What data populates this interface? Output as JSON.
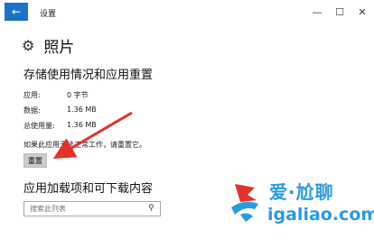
{
  "window": {
    "title": "设置",
    "back_glyph": "←",
    "minimize_glyph": "—",
    "maximize_glyph": "☐",
    "close_glyph": "✕"
  },
  "page": {
    "gear_glyph": "⚙",
    "title": "照片"
  },
  "storage": {
    "title": "存储使用情况和应用重置",
    "rows": [
      {
        "label": "应用:",
        "value": "0 字节"
      },
      {
        "label": "数据:",
        "value": "1.36 MB"
      },
      {
        "label": "总使用量:",
        "value": "1.36 MB"
      }
    ],
    "note": "如果此应用无法正常工作，请重置它。",
    "reset_label": "重置"
  },
  "addons": {
    "title": "应用加载项和可下载内容",
    "search_placeholder": "搜索此列表",
    "search_icon_glyph": "⚲"
  },
  "watermark": {
    "brand": "爱·尬聊",
    "url": "igaliao.com"
  },
  "colors": {
    "accent": "#1a73c8",
    "arrow": "#e4322b",
    "watermark": "#2a9be3"
  }
}
